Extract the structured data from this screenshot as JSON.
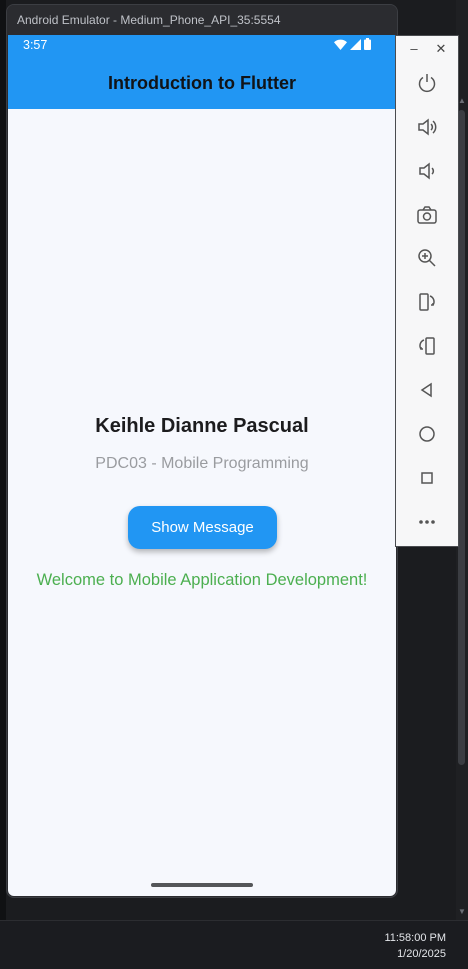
{
  "emulator": {
    "window_title": "Android Emulator - Medium_Phone_API_35:5554"
  },
  "status_bar": {
    "time": "3:57",
    "icons": [
      "wifi-icon",
      "signal-icon",
      "battery-icon"
    ]
  },
  "app_bar": {
    "title": "Introduction to Flutter"
  },
  "content": {
    "name": "Keihle Dianne Pascual",
    "subtitle": "PDC03 - Mobile Programming",
    "button_label": "Show Message",
    "message": "Welcome to Mobile Application Development!"
  },
  "side_toolbar": {
    "controls": [
      "minimize",
      "close"
    ],
    "buttons": [
      "power-icon",
      "volume-up-icon",
      "volume-down-icon",
      "camera-icon",
      "zoom-icon",
      "rotate-left-icon",
      "rotate-right-icon",
      "back-icon",
      "home-icon",
      "overview-icon",
      "more-icon"
    ]
  },
  "taskbar": {
    "time": "11:58:00 PM",
    "date": "1/20/2025"
  },
  "colors": {
    "primary": "#2196f3",
    "message_green": "#4caf50",
    "subtitle_gray": "#9a9ca0",
    "phone_background": "#f6f8fd"
  }
}
